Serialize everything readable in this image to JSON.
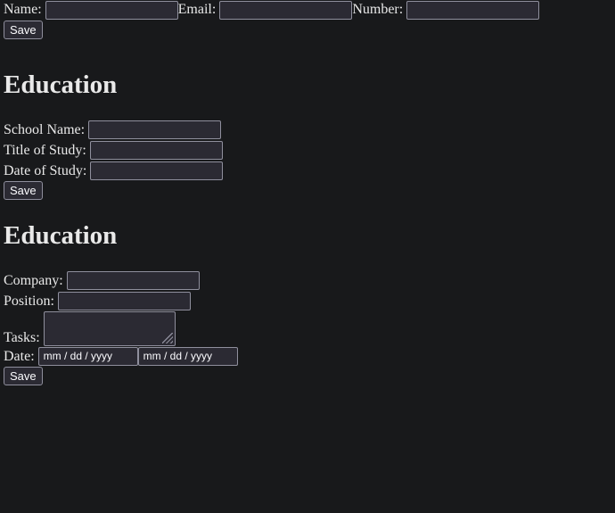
{
  "general": {
    "name_label": "Name:",
    "email_label": "Email:",
    "number_label": "Number:",
    "save_label": "Save"
  },
  "education": {
    "heading": "Education",
    "school_label": "School Name:",
    "title_label": "Title of Study:",
    "date_label": "Date of Study:",
    "save_label": "Save"
  },
  "experience": {
    "heading": "Education",
    "company_label": "Company:",
    "position_label": "Position:",
    "tasks_label": "Tasks:",
    "date_label": "Date:",
    "date_from_placeholder": "mm / dd / yyyy",
    "date_to_placeholder": "mm / dd / yyyy",
    "save_label": "Save"
  },
  "colors": {
    "background": "#18191b",
    "field_background": "#2b2a33",
    "field_border": "#8f8f9d",
    "text": "#e9e9e9"
  }
}
